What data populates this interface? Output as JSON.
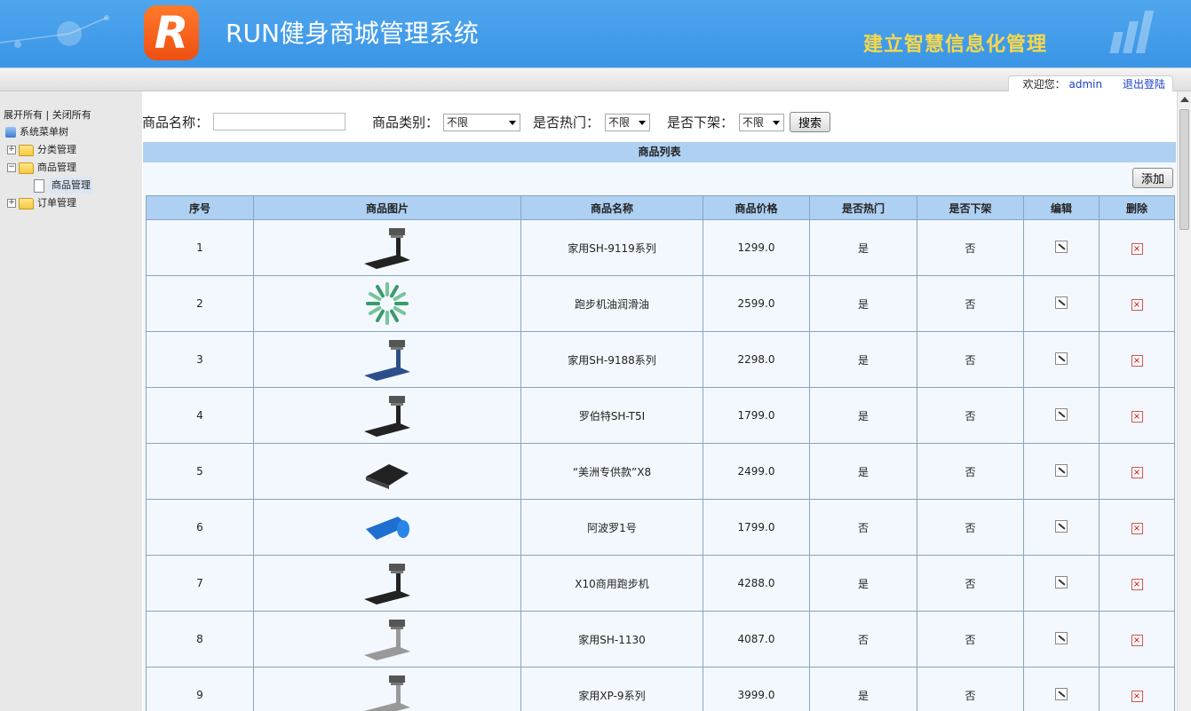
{
  "header": {
    "logo_letter": "R",
    "app_title": "RUN健身商城管理系统",
    "slogan": "建立智慧信息化管理"
  },
  "userbar": {
    "welcome_label": "欢迎您：",
    "username": "admin",
    "logout_label": "退出登陆"
  },
  "sidebar": {
    "expand_all": "展开所有",
    "separator": "|",
    "collapse_all": "关闭所有",
    "root_label": "系统菜单树",
    "items": [
      {
        "label": "分类管理",
        "state": "collapsed"
      },
      {
        "label": "商品管理",
        "state": "expanded",
        "children": [
          {
            "label": "商品管理",
            "selected": true
          }
        ]
      },
      {
        "label": "订单管理",
        "state": "collapsed"
      }
    ]
  },
  "search": {
    "name_label": "商品名称：",
    "name_value": "",
    "category_label": "商品类别：",
    "category_value": "不限",
    "hot_label": "是否热门：",
    "hot_value": "不限",
    "offshelf_label": "是否下架：",
    "offshelf_value": "不限",
    "search_button": "搜索"
  },
  "list": {
    "title": "商品列表",
    "add_button": "添加",
    "columns": [
      "序号",
      "商品图片",
      "商品名称",
      "商品价格",
      "是否热门",
      "是否下架",
      "编辑",
      "删除"
    ],
    "rows": [
      {
        "no": "1",
        "image": "treadmill-black",
        "name": "家用SH-9119系列",
        "price": "1299.0",
        "hot": "是",
        "off": "否"
      },
      {
        "no": "2",
        "image": "lubricant-green-pattern",
        "name": "跑步机油润滑油",
        "price": "2599.0",
        "hot": "是",
        "off": "否"
      },
      {
        "no": "3",
        "image": "treadmill-blue",
        "name": "家用SH-9188系列",
        "price": "2298.0",
        "hot": "是",
        "off": "否"
      },
      {
        "no": "4",
        "image": "treadmill-black",
        "name": "罗伯特SH-T5I",
        "price": "1799.0",
        "hot": "是",
        "off": "否"
      },
      {
        "no": "5",
        "image": "treadmill-mat",
        "name": "“美洲专供款”X8",
        "price": "2499.0",
        "hot": "是",
        "off": "否"
      },
      {
        "no": "6",
        "image": "blue-mat",
        "name": "阿波罗1号",
        "price": "1799.0",
        "hot": "否",
        "off": "否"
      },
      {
        "no": "7",
        "image": "treadmill-black",
        "name": "X10商用跑步机",
        "price": "4288.0",
        "hot": "是",
        "off": "否"
      },
      {
        "no": "8",
        "image": "treadmill-silver",
        "name": "家用SH-1130",
        "price": "4087.0",
        "hot": "否",
        "off": "否"
      },
      {
        "no": "9",
        "image": "treadmill-silver",
        "name": "家用XP-9系列",
        "price": "3999.0",
        "hot": "是",
        "off": "否"
      }
    ]
  },
  "colors": {
    "header_bg": "#3a95e6",
    "logo_bg": "#ee4f12",
    "slogan": "#f7d84a",
    "table_header": "#aed0f2",
    "table_bg": "#f2f8fd",
    "link": "#1a3fc6"
  },
  "icons": {
    "edit": "edit-icon",
    "delete": "delete-icon"
  }
}
